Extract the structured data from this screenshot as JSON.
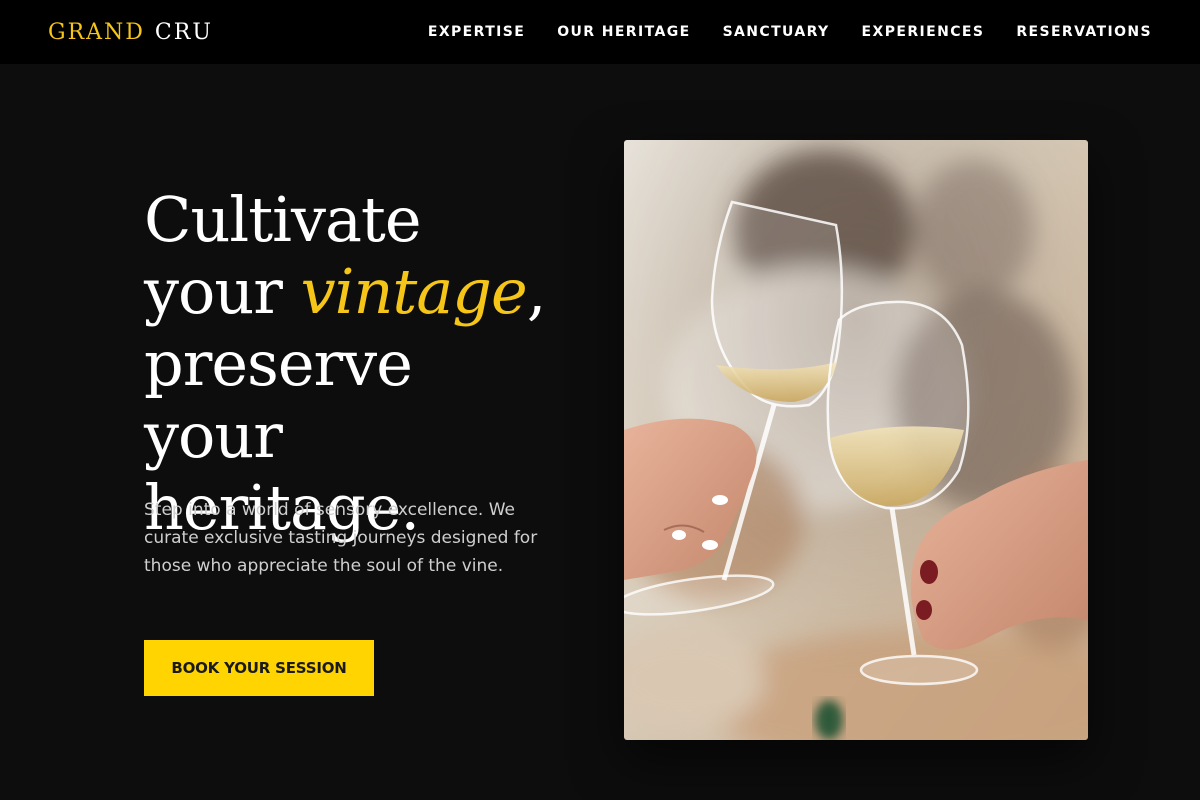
{
  "brand": {
    "part1": "GRAND",
    "part2": "CRU",
    "gold": "#f5c518"
  },
  "nav": [
    {
      "label": "EXPERTISE"
    },
    {
      "label": "OUR HERITAGE"
    },
    {
      "label": "SANCTUARY"
    },
    {
      "label": "EXPERIENCES"
    },
    {
      "label": "RESERVATIONS"
    }
  ],
  "hero": {
    "line1": "Cultivate",
    "line2_pre": "your ",
    "line2_accent": "vintage",
    "line2_post": ",",
    "line3": "preserve your",
    "line4": "heritage.",
    "lead": "Step into a world of sensory excellence. We curate exclusive tasting journeys designed for those who appreciate the soul of the vine.",
    "cta": "BOOK YOUR SESSION",
    "accent_color": "#f5c518",
    "button_color": "#ffd400"
  },
  "image": {
    "subject": "two hands toasting glasses of white wine"
  }
}
